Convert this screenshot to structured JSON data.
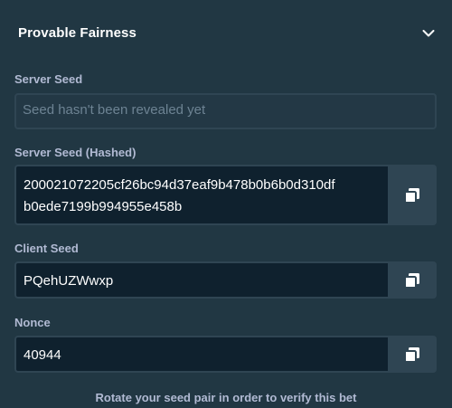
{
  "header": {
    "title": "Provable Fairness",
    "toggle_icon": "chevron-down-icon"
  },
  "server_seed": {
    "label": "Server Seed",
    "placeholder": "Seed hasn't been revealed yet"
  },
  "server_seed_hashed": {
    "label": "Server Seed (Hashed)",
    "value_line1": "200021072205cf26bc94d37eaf9b478b0b6b0d310df",
    "value_line2": "b0ede7199b994955e458b",
    "copy_icon": "copy-icon"
  },
  "client_seed": {
    "label": "Client Seed",
    "value": "PQehUZWwxp",
    "copy_icon": "copy-icon"
  },
  "nonce": {
    "label": "Nonce",
    "value": "40944",
    "copy_icon": "copy-icon"
  },
  "footer": {
    "text": "Rotate your seed pair in order to verify this bet"
  },
  "colors": {
    "background": "#213743",
    "input_bg": "#0f212e",
    "border": "#2f4553",
    "label": "#b1bad3",
    "placeholder": "#6d8393",
    "text": "#ffffff"
  }
}
